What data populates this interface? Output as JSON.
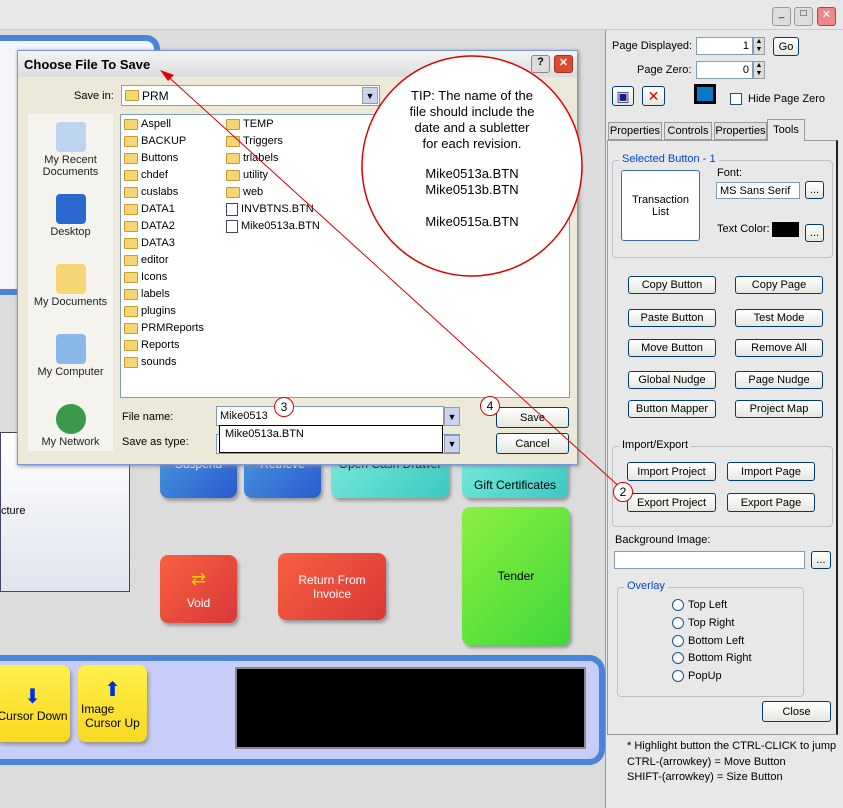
{
  "window": {
    "controls": [
      "minimize",
      "maximize",
      "close"
    ]
  },
  "background": {
    "panel_text": "cture",
    "buttons": {
      "suspend": "Suspend",
      "retrieve": "Retrieve",
      "open_cash_drawer": "Open Cash Drawer",
      "gift_certificates": "Gift Certificates",
      "tender": "Tender",
      "void": "Void",
      "return_from_invoice": "Return From Invoice",
      "cursor_down": "Cursor Down",
      "cursor_up": "Cursor Up",
      "image_label": "Image"
    },
    "colors": {
      "blue": "#3a78d8",
      "teal": "#5fe0d0",
      "red": "#e84a3a",
      "green": "#5fe040",
      "yellow": "#ffe63a"
    }
  },
  "dialog": {
    "title": "Choose File To Save",
    "save_in_label": "Save in:",
    "save_in_value": "PRM",
    "places": [
      "My Recent Documents",
      "Desktop",
      "My Documents",
      "My Computer",
      "My Network"
    ],
    "files_col1": [
      "Aspell",
      "BACKUP",
      "Buttons",
      "chdef",
      "cuslabs",
      "DATA1",
      "DATA2",
      "DATA3",
      "editor",
      "Icons",
      "labels",
      "plugins",
      "PRMReports",
      "Reports",
      "sounds"
    ],
    "files_col2_folders": [
      "TEMP",
      "Triggers",
      "trlabels",
      "utility",
      "web"
    ],
    "files_col2_files": [
      "INVBTNS.BTN",
      "Mike0513a.BTN"
    ],
    "file_name_label": "File name:",
    "file_name_value": "Mike0513",
    "autocomplete": "Mike0513a.BTN",
    "save_as_type_label": "Save as type:",
    "save_label": "Save",
    "cancel_label": "Cancel"
  },
  "annotation": {
    "tip_lines": [
      "TIP: The name of the",
      "file should include the",
      "date and a subletter",
      "for each revision."
    ],
    "examples": [
      "Mike0513a.BTN",
      "Mike0513b.BTN",
      "Mike0515a.BTN"
    ],
    "steps": [
      "2",
      "3",
      "4"
    ],
    "color": "#dd0000"
  },
  "right_panel": {
    "page_displayed_label": "Page Displayed:",
    "page_displayed_value": "1",
    "go_label": "Go",
    "page_zero_label": "Page Zero:",
    "page_zero_value": "0",
    "hide_page_zero_label": "Hide Page Zero",
    "hide_page_zero_checked": false,
    "page_color": "#0a78c8",
    "tabs": [
      "Properties",
      "Controls",
      "Properties",
      "Tools"
    ],
    "active_tab": "Tools",
    "selected_button_legend": "Selected Button - 1",
    "selected_button_preview": "Transaction List",
    "font_label": "Font:",
    "font_value": "MS Sans Serif",
    "text_color_label": "Text Color:",
    "text_color": "#000000",
    "tool_buttons": [
      [
        "Copy Button",
        "Copy Page"
      ],
      [
        "Paste Button",
        "Test Mode"
      ],
      [
        "Move Button",
        "Remove All"
      ],
      [
        "Global Nudge",
        "Page Nudge"
      ],
      [
        "Button Mapper",
        "Project Map"
      ]
    ],
    "import_export_legend": "Import/Export",
    "import_project": "Import Project",
    "import_page": "Import Page",
    "export_project": "Export Project",
    "export_page": "Export Page",
    "background_image_label": "Background Image:",
    "background_image_value": "",
    "overlay_legend": "Overlay",
    "overlay_options": [
      "Top Left",
      "Top Right",
      "Bottom Left",
      "Bottom Right",
      "PopUp"
    ],
    "close_label": "Close",
    "footer": [
      "* Highlight button the CTRL-CLICK to jump",
      "CTRL-(arrowkey) = Move Button",
      "SHIFT-(arrowkey) = Size Button"
    ]
  }
}
